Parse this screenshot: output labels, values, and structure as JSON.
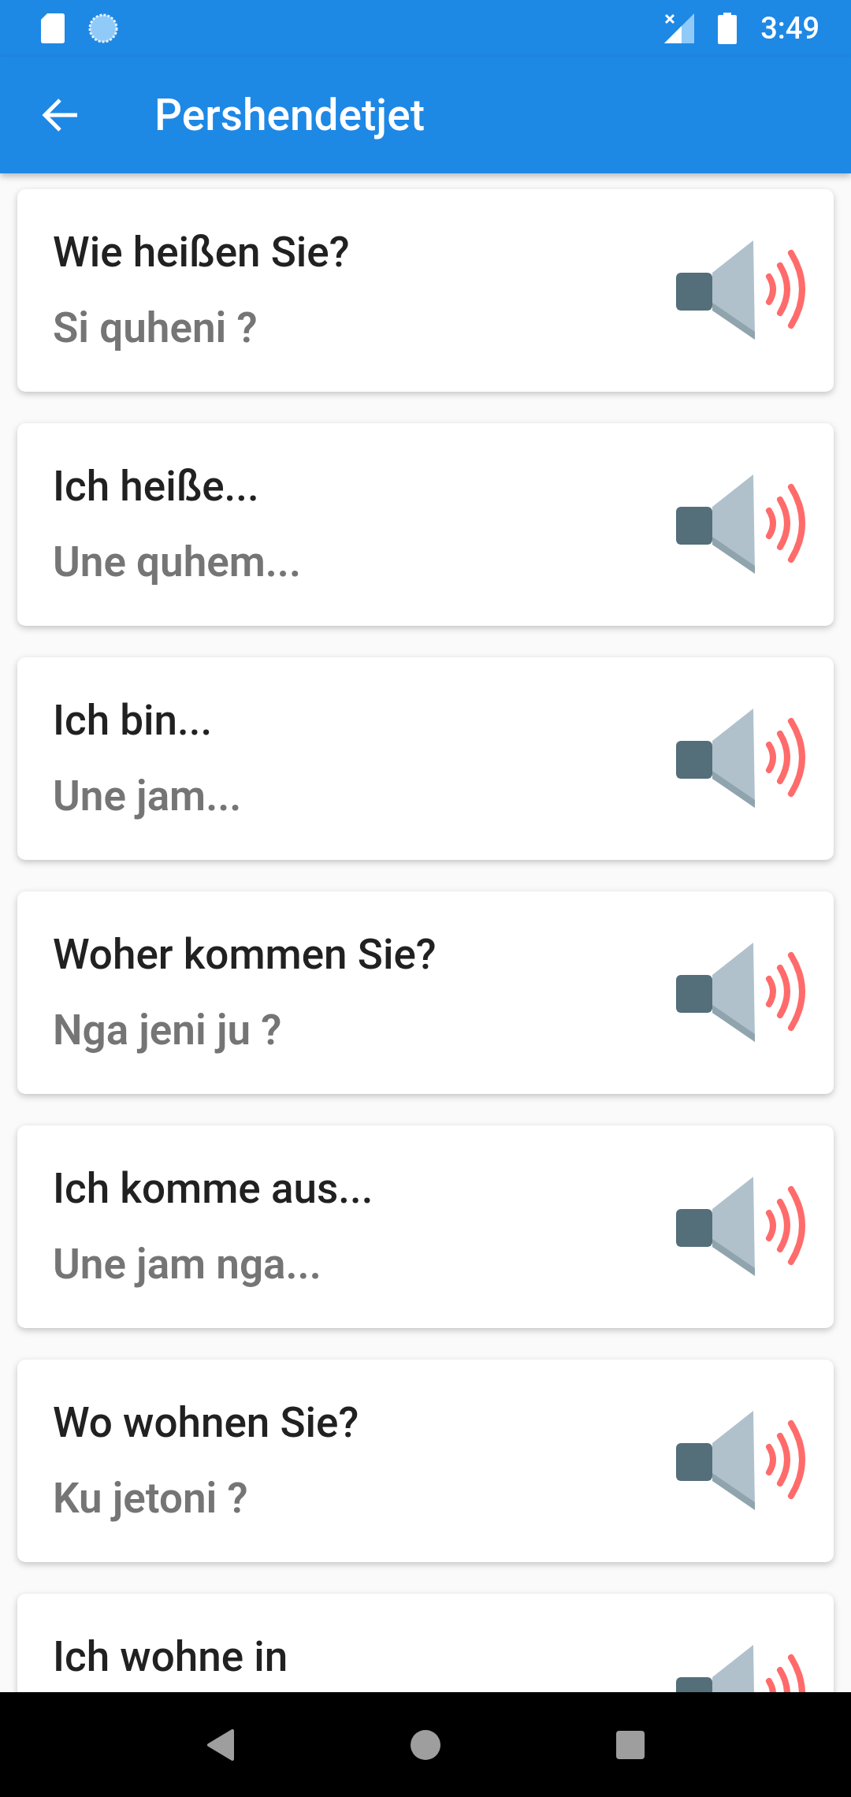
{
  "status_bar": {
    "time": "3:49"
  },
  "app_bar": {
    "title": "Pershendetjet"
  },
  "phrases": [
    {
      "text": "Wie heißen Sie?",
      "translation": "Si quheni ?"
    },
    {
      "text": "Ich heiße...",
      "translation": "Une quhem..."
    },
    {
      "text": "Ich bin...",
      "translation": "Une jam..."
    },
    {
      "text": "Woher kommen Sie?",
      "translation": "Nga jeni ju ?"
    },
    {
      "text": "Ich komme aus...",
      "translation": "Une jam nga..."
    },
    {
      "text": "Wo wohnen Sie?",
      "translation": "Ku jetoni ?"
    },
    {
      "text": "Ich wohne in"
    }
  ]
}
